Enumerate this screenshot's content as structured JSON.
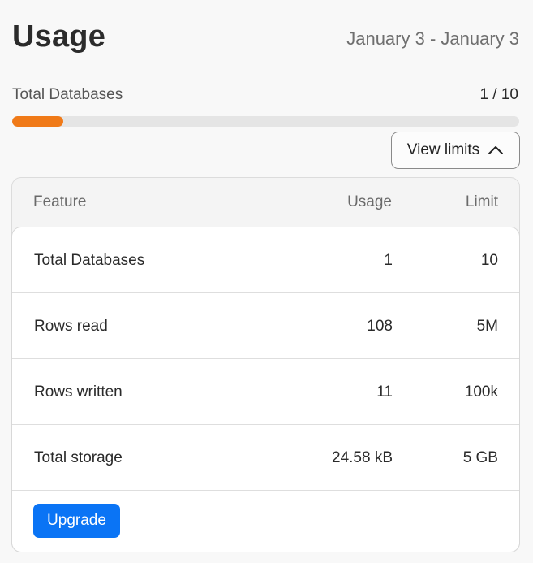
{
  "header": {
    "title": "Usage",
    "date_range": "January 3 - January 3"
  },
  "summary": {
    "label": "Total Databases",
    "count": "1 / 10",
    "used": 1,
    "limit": 10,
    "progress_color": "#f07a18"
  },
  "view_limits": {
    "label": "View limits",
    "icon": "chevron-up-icon"
  },
  "table": {
    "columns": [
      "Feature",
      "Usage",
      "Limit"
    ],
    "rows": [
      [
        "Total Databases",
        "1",
        "10"
      ],
      [
        "Rows read",
        "108",
        "5M"
      ],
      [
        "Rows written",
        "11",
        "100k"
      ],
      [
        "Total storage",
        "24.58 kB",
        "5 GB"
      ]
    ]
  },
  "upgrade_button": {
    "label": "Upgrade",
    "color": "#0a74f5"
  }
}
